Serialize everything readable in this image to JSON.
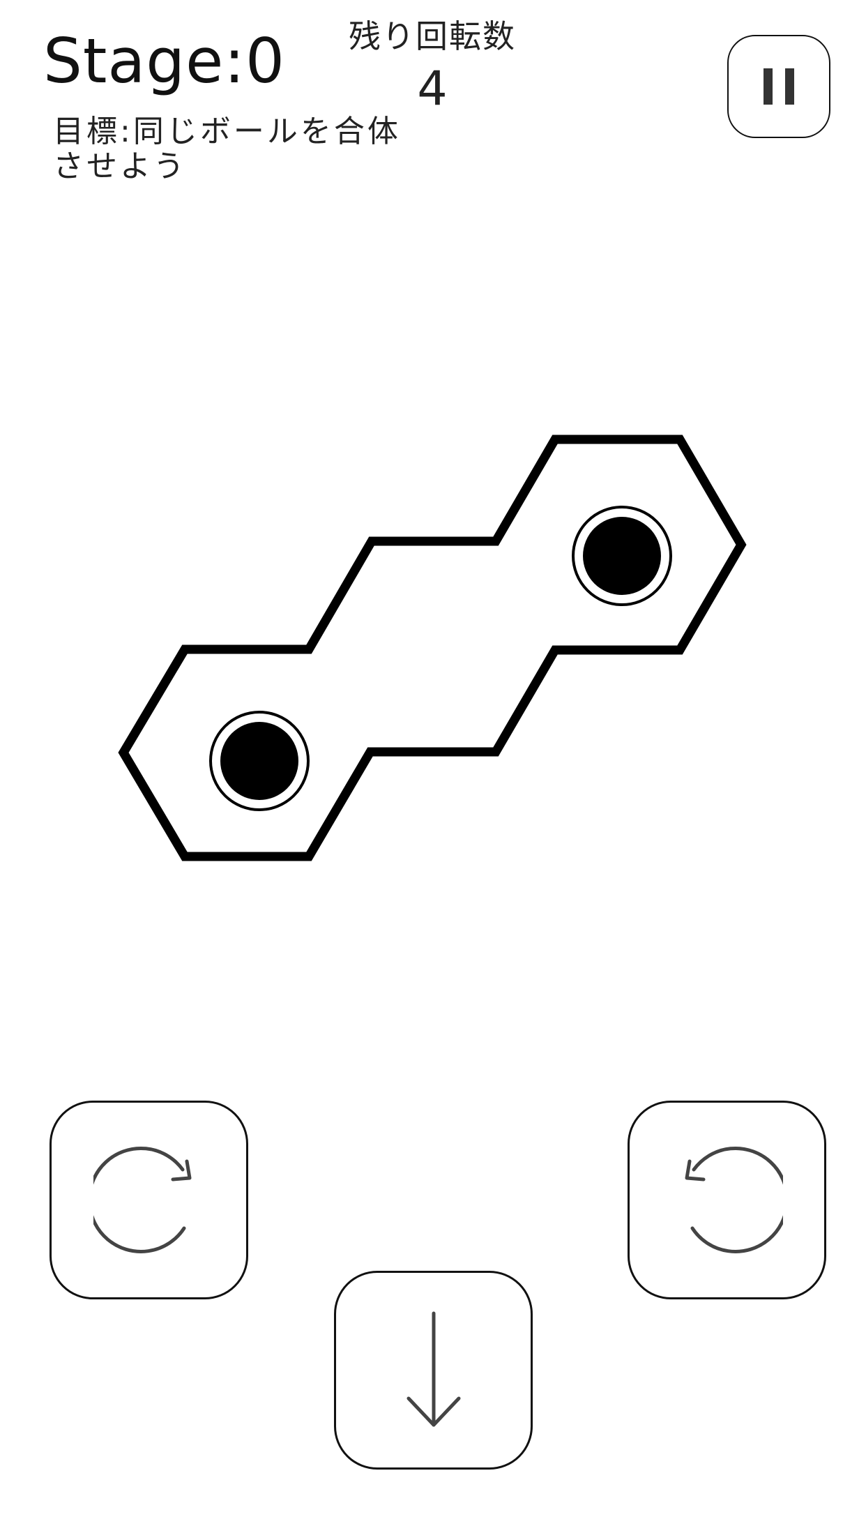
{
  "header": {
    "stage_label": "Stage:0",
    "goal_text": "目標:同じボールを合体させよう",
    "remaining_label": "残り回転数",
    "remaining_count": "4"
  },
  "controls": {
    "pause_icon": "pause-icon",
    "rotate_clockwise_icon": "rotate-clockwise-icon",
    "rotate_counterclockwise_icon": "rotate-counterclockwise-icon",
    "drop_icon": "arrow-down-icon"
  },
  "board": {
    "shape": "zigzag hex-cell chain",
    "balls": [
      {
        "color": "#000000",
        "cell": "bottom-left"
      },
      {
        "color": "#000000",
        "cell": "top-right"
      }
    ]
  },
  "colors": {
    "background": "#ffffff",
    "outline": "#000000",
    "icon": "#444444"
  }
}
